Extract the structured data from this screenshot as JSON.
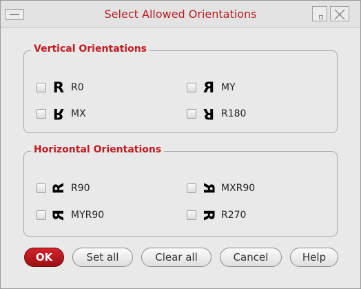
{
  "window": {
    "title": "Select Allowed Orientations",
    "accent_color": "#b51d22",
    "icons": {
      "menu": "window-menu-icon",
      "minimize": "minimize-icon",
      "close": "close-icon"
    }
  },
  "vertical": {
    "legend": "Vertical Orientations",
    "options": [
      {
        "label": "R0",
        "glyph": "R",
        "checked": false
      },
      {
        "label": "MY",
        "glyph": "R",
        "checked": false
      },
      {
        "label": "MX",
        "glyph": "R",
        "checked": false
      },
      {
        "label": "R180",
        "glyph": "R",
        "checked": false
      }
    ]
  },
  "horizontal": {
    "legend": "Horizontal Orientations",
    "options": [
      {
        "label": "R90",
        "glyph": "R",
        "checked": false
      },
      {
        "label": "MXR90",
        "glyph": "R",
        "checked": false
      },
      {
        "label": "MYR90",
        "glyph": "R",
        "checked": false
      },
      {
        "label": "R270",
        "glyph": "R",
        "checked": false
      }
    ]
  },
  "buttons": {
    "ok": "OK",
    "set_all": "Set all",
    "clear_all": "Clear all",
    "cancel": "Cancel",
    "help": "Help"
  }
}
